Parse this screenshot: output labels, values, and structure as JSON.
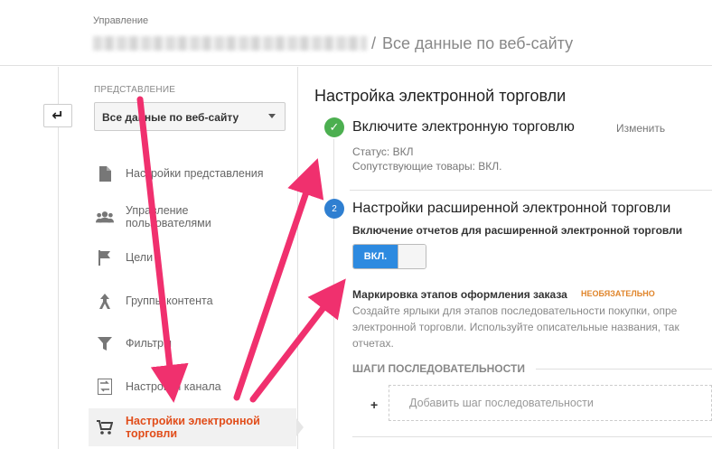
{
  "header": {
    "crumb": "Управление",
    "separator": "/",
    "view_title": "Все данные по веб-сайту"
  },
  "sidebar": {
    "view_label": "ПРЕДСТАВЛЕНИЕ",
    "view_select": "Все данные по веб-сайту",
    "items": [
      {
        "label": "Настройки представления",
        "icon": "document-icon"
      },
      {
        "label": "Управление пользователями",
        "icon": "users-icon"
      },
      {
        "label": "Цели",
        "icon": "flag-icon"
      },
      {
        "label": "Группы контента",
        "icon": "content-group-icon"
      },
      {
        "label": "Фильтры",
        "icon": "filter-icon"
      },
      {
        "label": "Настройки канала",
        "icon": "channel-icon"
      },
      {
        "label": "Настройки электронной торговли",
        "icon": "cart-icon"
      }
    ]
  },
  "main": {
    "title": "Настройка электронной торговли",
    "step1": {
      "title": "Включите электронную торговлю",
      "edit": "Изменить",
      "status": "Статус: ВКЛ",
      "related": "Сопутствующие товары: ВКЛ."
    },
    "step2": {
      "number": "2",
      "title": "Настройки расширенной электронной торговли",
      "enable_label": "Включение отчетов для расширенной электронной торговли",
      "toggle_on": "ВКЛ.",
      "mark_label": "Маркировка этапов оформления заказа",
      "optional": "НЕОБЯЗАТЕЛЬНО",
      "desc": "Создайте ярлыки для этапов последовательности покупки, опре электронной торговли. Используйте описательные названия, так отчетах.",
      "steps_label": "ШАГИ ПОСЛЕДОВАТЕЛЬНОСТИ",
      "plus": "+",
      "add_step": "Добавить шаг последовательности"
    }
  },
  "colors": {
    "accent_blue": "#2d8ae0",
    "success_green": "#4caf50",
    "active_orange": "#e14d1a",
    "annotation_pink": "#f0306e"
  }
}
